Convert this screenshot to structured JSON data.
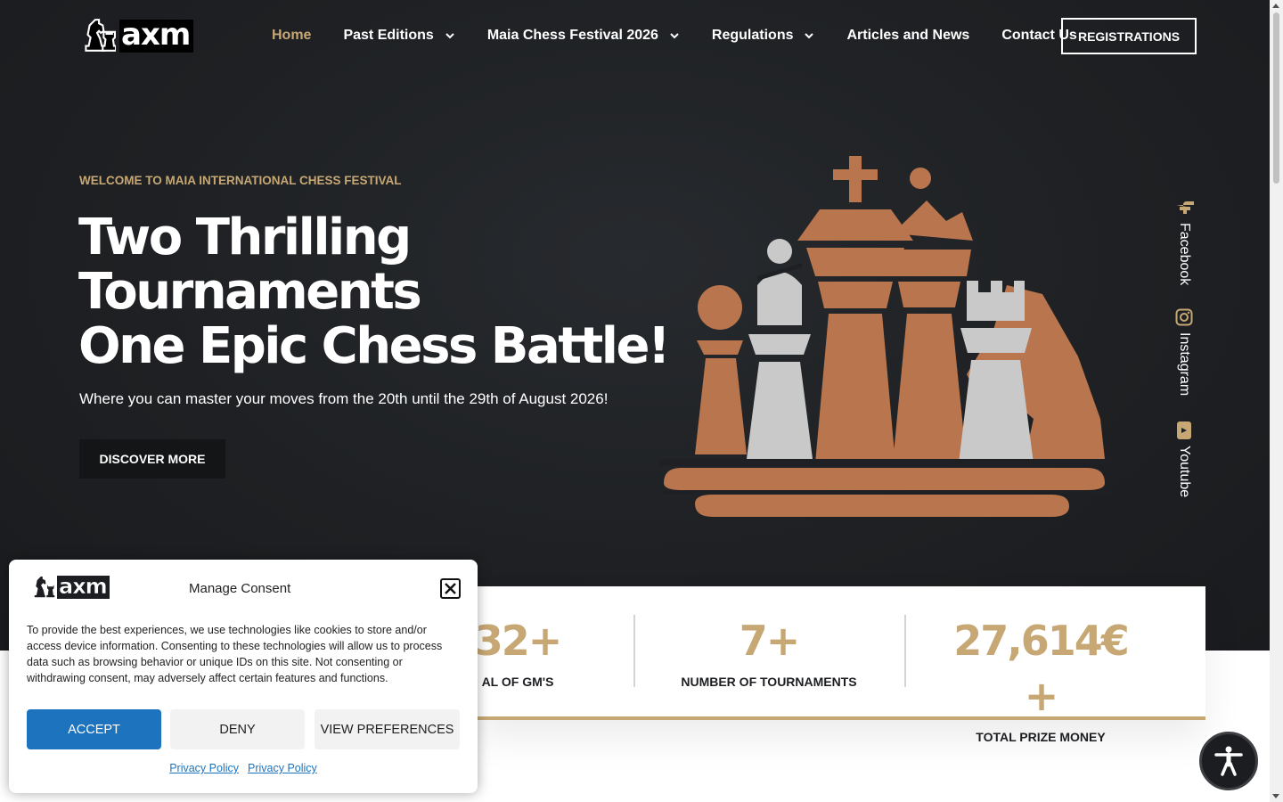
{
  "header": {
    "logo_text": "axm",
    "nav": [
      {
        "label": "Home",
        "dropdown": false,
        "active": true
      },
      {
        "label": "Past Editions",
        "dropdown": true
      },
      {
        "label": "Maia Chess Festival 2026",
        "dropdown": true
      },
      {
        "label": "Regulations",
        "dropdown": true
      },
      {
        "label": "Articles and News",
        "dropdown": false
      },
      {
        "label": "Contact Us",
        "dropdown": false
      }
    ],
    "cta_label": "REGISTRATIONS"
  },
  "hero": {
    "eyebrow": "WELCOME TO MAIA INTERNATIONAL CHESS FESTIVAL",
    "headline_line1": "Two Thrilling",
    "headline_line2": "Tournaments",
    "headline_line3": "One Epic Chess Battle!",
    "subheadline": "Where you can master your moves from the 20th until the 29th of August 2026!",
    "button_label": "DISCOVER MORE"
  },
  "social": [
    {
      "label": "Facebook",
      "icon": "facebook-icon"
    },
    {
      "label": "Instagram",
      "icon": "instagram-icon"
    },
    {
      "label": "Youtube",
      "icon": "youtube-icon"
    }
  ],
  "stats": [
    {
      "value": "32+",
      "label": "AL OF GM'S"
    },
    {
      "value": "7+",
      "label": "NUMBER OF TOURNAMENTS"
    },
    {
      "value": "27,614€+",
      "label": "TOTAL PRIZE MONEY"
    }
  ],
  "consent": {
    "logo_text": "axm",
    "title": "Manage Consent",
    "body": "To provide the best experiences, we use technologies like cookies to store and/or access device information. Consenting to these technologies will allow us to process data such as browsing behavior or unique IDs on this site. Not consenting or withdrawing consent, may adversely affect certain features and functions.",
    "accept_label": "ACCEPT",
    "deny_label": "DENY",
    "preferences_label": "VIEW PREFERENCES",
    "links": [
      "Privacy Policy",
      "Privacy Policy"
    ]
  },
  "colors": {
    "accent": "#c7a874",
    "copper": "#b9754d",
    "silver": "#c9c9c9",
    "background": "#1c1e21",
    "consent_accept": "#1e73be"
  }
}
